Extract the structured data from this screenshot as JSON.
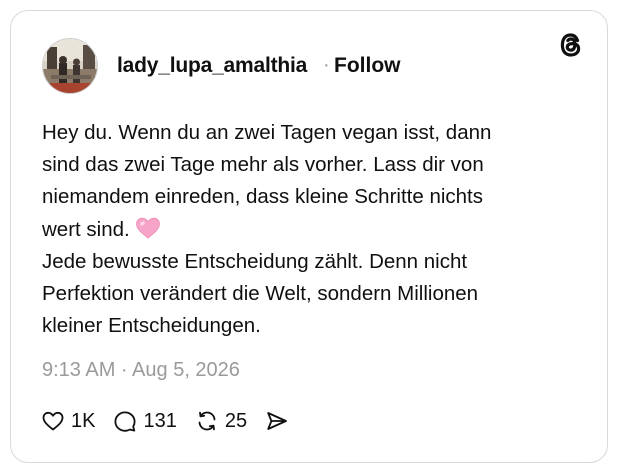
{
  "post": {
    "username": "lady_lupa_amalthia",
    "separator": "·",
    "follow_label": "Follow",
    "text_lines": [
      "Hey du. Wenn du an zwei Tagen vegan isst, dann",
      "sind das zwei Tage mehr als vorher. Lass dir von",
      "niemandem einreden, dass kleine Schritte nichts",
      "wert sind.",
      "Jede bewusste Entscheidung zählt. Denn nicht",
      "Perfektion verändert die Welt, sondern Millionen",
      "kleiner Entscheidungen."
    ],
    "emoji": "pink-heart-emoji",
    "timestamp": "9:13 AM · Aug 5, 2026"
  },
  "actions": {
    "likes": "1K",
    "replies": "131",
    "reposts": "25"
  },
  "icons": {
    "brand": "threads-logo-icon",
    "like": "heart-outline-icon",
    "reply": "speech-bubble-icon",
    "repost": "repost-arrows-icon",
    "share": "send-icon"
  },
  "colors": {
    "text": "#101010",
    "muted": "#9a9a9a",
    "border": "#d9d9d9",
    "emoji_pink": "#f6a5c8"
  }
}
